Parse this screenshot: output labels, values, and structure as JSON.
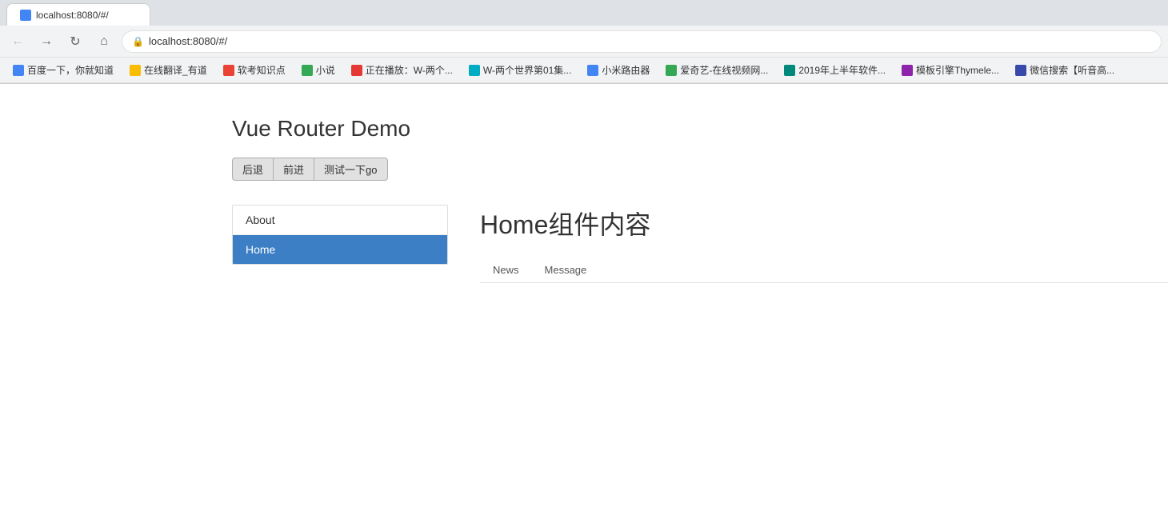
{
  "browser": {
    "tab_title": "localhost:8080/#/",
    "address": "localhost:8080/#/",
    "back_label": "←",
    "forward_label": "→",
    "reload_label": "↺",
    "home_label": "⌂"
  },
  "bookmarks": [
    {
      "id": "bm1",
      "label": "百度一下，你就知道",
      "color": "bm-blue"
    },
    {
      "id": "bm2",
      "label": "在线翻译_有道",
      "color": "bm-yellow"
    },
    {
      "id": "bm3",
      "label": "软考知识点",
      "color": "bm-orange"
    },
    {
      "id": "bm4",
      "label": "小说",
      "color": "bm-green"
    },
    {
      "id": "bm5",
      "label": "正在播放：W-两个...",
      "color": "bm-red"
    },
    {
      "id": "bm6",
      "label": "W-两个世界第01集...",
      "color": "bm-lightblue"
    },
    {
      "id": "bm7",
      "label": "小米路由器",
      "color": "bm-blue"
    },
    {
      "id": "bm8",
      "label": "爱奇艺-在线视频网...",
      "color": "bm-green"
    },
    {
      "id": "bm9",
      "label": "2019年上半年软件...",
      "color": "bm-teal"
    },
    {
      "id": "bm10",
      "label": "模板引擎Thymele...",
      "color": "bm-purple"
    },
    {
      "id": "bm11",
      "label": "微信搜索【听音高...",
      "color": "bm-indigo"
    }
  ],
  "app": {
    "title": "Vue Router Demo",
    "buttons": {
      "back": "后退",
      "forward": "前进",
      "test": "测试一下go"
    },
    "nav_items": [
      {
        "id": "about",
        "label": "About",
        "active": false
      },
      {
        "id": "home",
        "label": "Home",
        "active": true
      }
    ],
    "component_title": "Home组件内容",
    "sub_nav": [
      {
        "id": "news",
        "label": "News"
      },
      {
        "id": "message",
        "label": "Message"
      }
    ]
  }
}
